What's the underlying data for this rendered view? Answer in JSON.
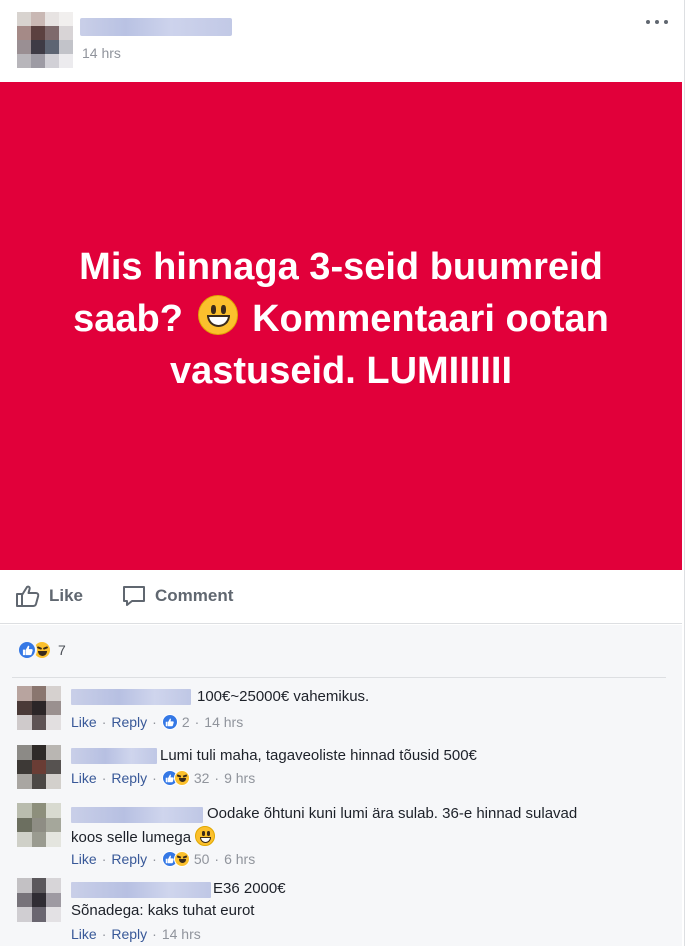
{
  "post": {
    "time": "14 hrs",
    "text_line1": "Mis hinnaga 3-seid buumreid",
    "text_line2_a": "saab?",
    "text_line2_b": "Kommentaari ootan",
    "text_line3": "vastuseid. LUMIIIIII",
    "background_color": "#e1003a"
  },
  "actions": {
    "like_label": "Like",
    "comment_label": "Comment"
  },
  "reactions": {
    "types": [
      "like-icon",
      "haha-icon"
    ],
    "count": "7"
  },
  "comments": [
    {
      "text": "100€~25000€ vahemikus.",
      "like_label": "Like",
      "reply_label": "Reply",
      "reaction_count": "2",
      "time": "14 hrs"
    },
    {
      "text": "Lumi tuli maha, tagaveoliste hinnad tõusid 500€",
      "like_label": "Like",
      "reply_label": "Reply",
      "reaction_count": "32",
      "time": "9 hrs"
    },
    {
      "text_line1": "Oodake õhtuni kuni lumi ära sulab. 36-e hinnad sulavad",
      "text_line2": "koos selle lumega",
      "like_label": "Like",
      "reply_label": "Reply",
      "reaction_count": "50",
      "time": "6 hrs"
    },
    {
      "text_line1": "E36 2000€",
      "text_line2": "Sõnadega: kaks tuhat eurot",
      "like_label": "Like",
      "reply_label": "Reply",
      "time": "14 hrs"
    }
  ]
}
